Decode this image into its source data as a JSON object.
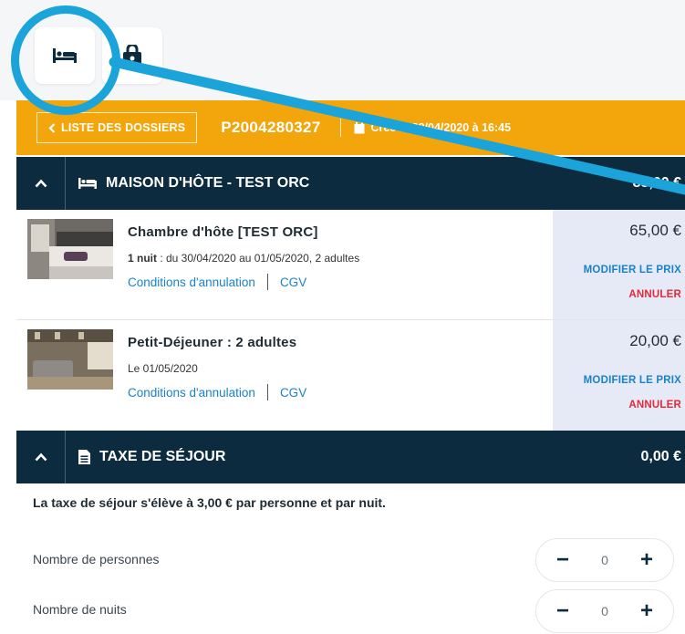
{
  "tabs": {
    "hebergement_icon": "bed-icon",
    "activite_icon": "bag-lock-icon"
  },
  "dossier": {
    "back_label": "LISTE DES DOSSIERS",
    "number": "P2004280327",
    "created_label": "Créé le 28/04/2020 à 16:45"
  },
  "maison": {
    "title": "MAISON D'HÔTE - TEST ORC",
    "total": "85,00 €"
  },
  "items": [
    {
      "name": "Chambre d'hôte [TEST ORC]",
      "details_bold": "1 nuit",
      "details_rest": " : du 30/04/2020 au 01/05/2020, 2 adultes",
      "link_conditions": "Conditions d'annulation",
      "link_cgv": "CGV",
      "price": "65,00 €",
      "modify_label": "MODIFIER LE PRIX",
      "cancel_label": "ANNULER"
    },
    {
      "name": "Petit-Déjeuner : 2 adultes",
      "details_bold": "",
      "details_rest": "Le 01/05/2020",
      "link_conditions": "Conditions d'annulation",
      "link_cgv": "CGV",
      "price": "20,00 €",
      "modify_label": "MODIFIER LE PRIX",
      "cancel_label": "ANNULER"
    }
  ],
  "taxe": {
    "title": "TAXE DE SÉJOUR",
    "total": "0,00 €",
    "info": "La taxe de séjour s'élève à 3,00 € par personne et par nuit.",
    "rows": [
      {
        "label": "Nombre de personnes",
        "value": "0",
        "minus": "−",
        "plus": "+"
      },
      {
        "label": "Nombre de nuits",
        "value": "0",
        "minus": "−",
        "plus": "+"
      }
    ]
  },
  "colors": {
    "accent": "#f3a60b",
    "header_dark": "#0c2b3f",
    "link": "#1a82c8",
    "danger": "#e22a3a",
    "annotation": "#1aa4da"
  }
}
